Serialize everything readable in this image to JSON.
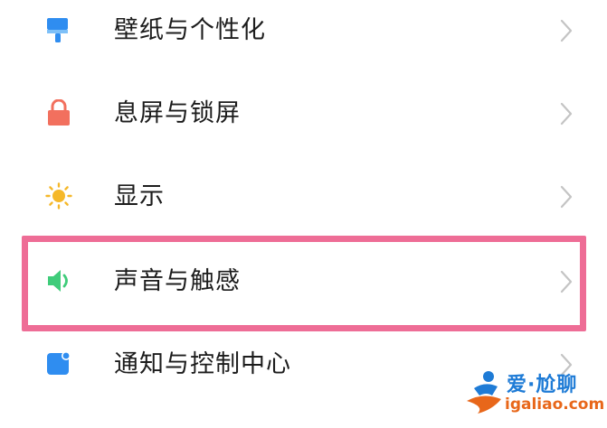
{
  "settings": {
    "items": [
      {
        "label": "壁纸与个性化",
        "icon": "paintbrush-icon",
        "color": "#2f8df0"
      },
      {
        "label": "息屏与锁屏",
        "icon": "lock-icon",
        "color": "#f2705e"
      },
      {
        "label": "显示",
        "icon": "sun-icon",
        "color": "#f5b82a"
      },
      {
        "label": "声音与触感",
        "icon": "speaker-icon",
        "color": "#3fcc7a"
      },
      {
        "label": "通知与控制中心",
        "icon": "notification-icon",
        "color": "#2f8df0"
      }
    ],
    "highlight_color": "#ee6d96",
    "chevron_color": "#c4c4c4"
  },
  "watermark": {
    "text_top": "爱·尬聊",
    "text_bottom": "igaliao.com"
  }
}
